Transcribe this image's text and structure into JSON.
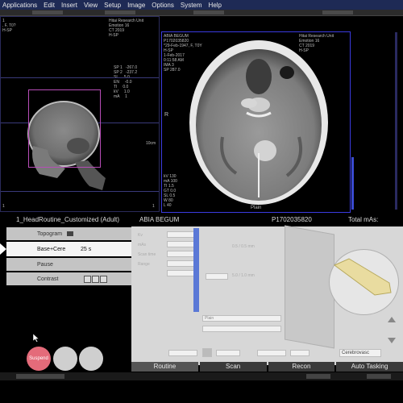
{
  "menu": [
    "Applications",
    "Edit",
    "Insert",
    "View",
    "Setup",
    "Image",
    "Options",
    "System",
    "Help"
  ],
  "scout": {
    "overlay_left": "1\n, F, T0?\nH-SP",
    "overlay_right": "Hitai Research Unit\nEmotion 16\nCT 2019\nH-SP",
    "params": "SP 1   -267.0\nSP 2   -237.2\nSL     5.0\nEN     -0.0\nTI     0.0\nkV     1.0\nmA     1",
    "bottom_left": "1",
    "bottom_right": "1",
    "scale_label": "10cm"
  },
  "axial": {
    "overlay_left": "ABIA BEGUM\nP1702035820\n*29-Feb-1947, F, T0Y\nH-SP\n1-Feb-2017\n0:11:58 AM\nIMA 3\nSP 287.0",
    "overlay_right": "Hitai Research Unit\nEmotion 16\nCT 2019\nH-SP",
    "overlay_bottom": "kV 130\nmA 100\nTI 1.5\nGT 0.0\nSL 0.5\nW 80\nL 40",
    "label_plain": "Plain",
    "left_marker": "R"
  },
  "protocol": {
    "name": "1_HeadRoutine_Customized (Adult)",
    "patient": "ABIA BEGUM",
    "patient_id": "P1702035820",
    "total_mas_label": "Total mAs:"
  },
  "protocol_list": [
    {
      "label": "Topogram",
      "time": ""
    },
    {
      "label": "Base+Cere",
      "time": "25 s"
    },
    {
      "label": "Pause",
      "time": ""
    },
    {
      "label": "Contrast",
      "time": ""
    }
  ],
  "round_buttons": {
    "suspend": "Suspend",
    "b2": "",
    "b3": ""
  },
  "params_panel": {
    "field_plain": "Plain",
    "dropdown_kernel": "Cerebrovasc",
    "label_a": "Kv",
    "label_b": "mAs",
    "label_c": "Scan time",
    "label_d": "Range",
    "slice_note": "0.5 / 0.5 mm",
    "recon_note": "5.0 / 1.0 mm"
  },
  "tabs": [
    "Routine",
    "Scan",
    "Recon",
    "Auto Tasking"
  ],
  "colors": {
    "menubar": "#1e2a55",
    "accent_blue": "#3b3be0",
    "suspend": "#e46b7a",
    "scan_box": "#b84db8"
  }
}
